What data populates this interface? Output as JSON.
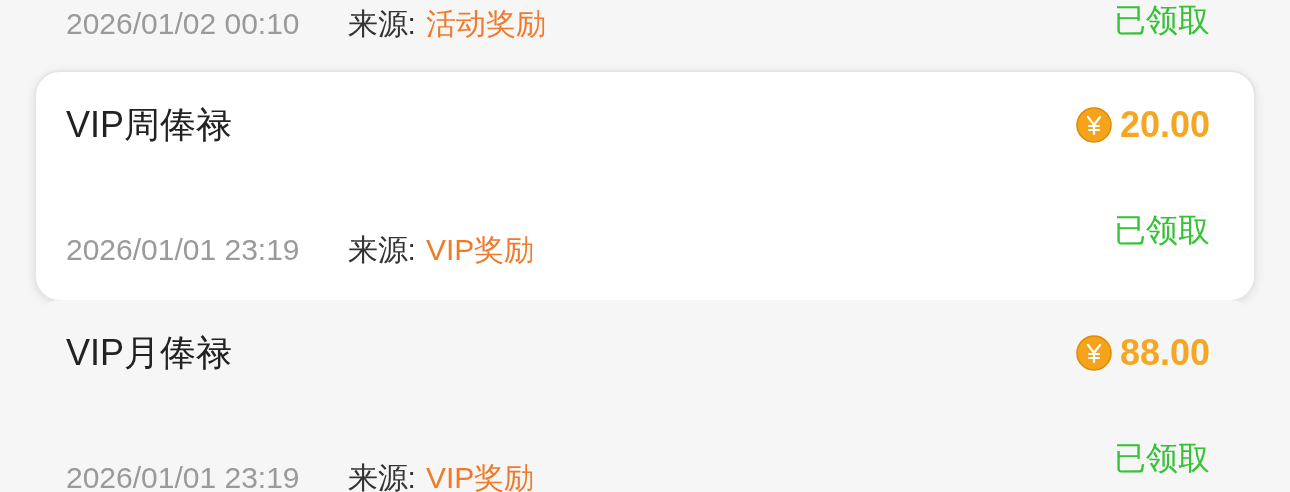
{
  "records": [
    {
      "time": "2026/01/02 00:10",
      "source_label": "来源:",
      "source": "活动奖励",
      "status": "已领取",
      "highlighted": false
    },
    {
      "title": "VIP周俸禄",
      "amount": "20.00",
      "time": "2026/01/01 23:19",
      "source_label": "来源:",
      "source": "VIP奖励",
      "status": "已领取",
      "highlighted": true
    },
    {
      "title": "VIP月俸禄",
      "amount": "88.00",
      "time": "2026/01/01 23:19",
      "source_label": "来源:",
      "source": "VIP奖励",
      "status": "已领取",
      "highlighted": false
    }
  ]
}
